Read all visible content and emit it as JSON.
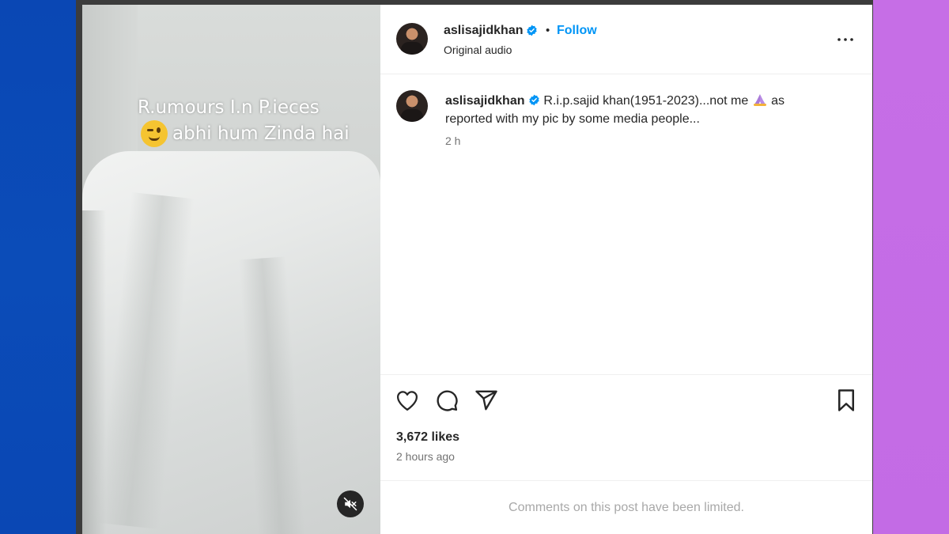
{
  "media": {
    "overlay_line1": "R.umours I.n P.ieces",
    "overlay_line2": "abhi hum Zinda hai",
    "mute_icon": "speaker-muted-icon"
  },
  "header": {
    "username": "aslisajidkhan",
    "verified_icon": "verified-badge-icon",
    "separator": "•",
    "follow_label": "Follow",
    "audio_label": "Original audio",
    "more_icon": "more-horizontal-icon"
  },
  "caption": {
    "username": "aslisajidkhan",
    "text_before": "R.i.p.sajid khan(1951-2023)...not me",
    "text_after": "as reported with my pic by some media people...",
    "time": "2 h"
  },
  "actions": {
    "like_icon": "heart-icon",
    "comment_icon": "comment-icon",
    "share_icon": "paper-plane-icon",
    "save_icon": "bookmark-icon",
    "likes": "3,672 likes",
    "posted": "2 hours ago"
  },
  "comments": {
    "limited_text": "Comments on this post have been limited."
  },
  "colors": {
    "accent": "#0095f6",
    "text": "#262626",
    "muted": "#737373",
    "border": "#efefef"
  }
}
